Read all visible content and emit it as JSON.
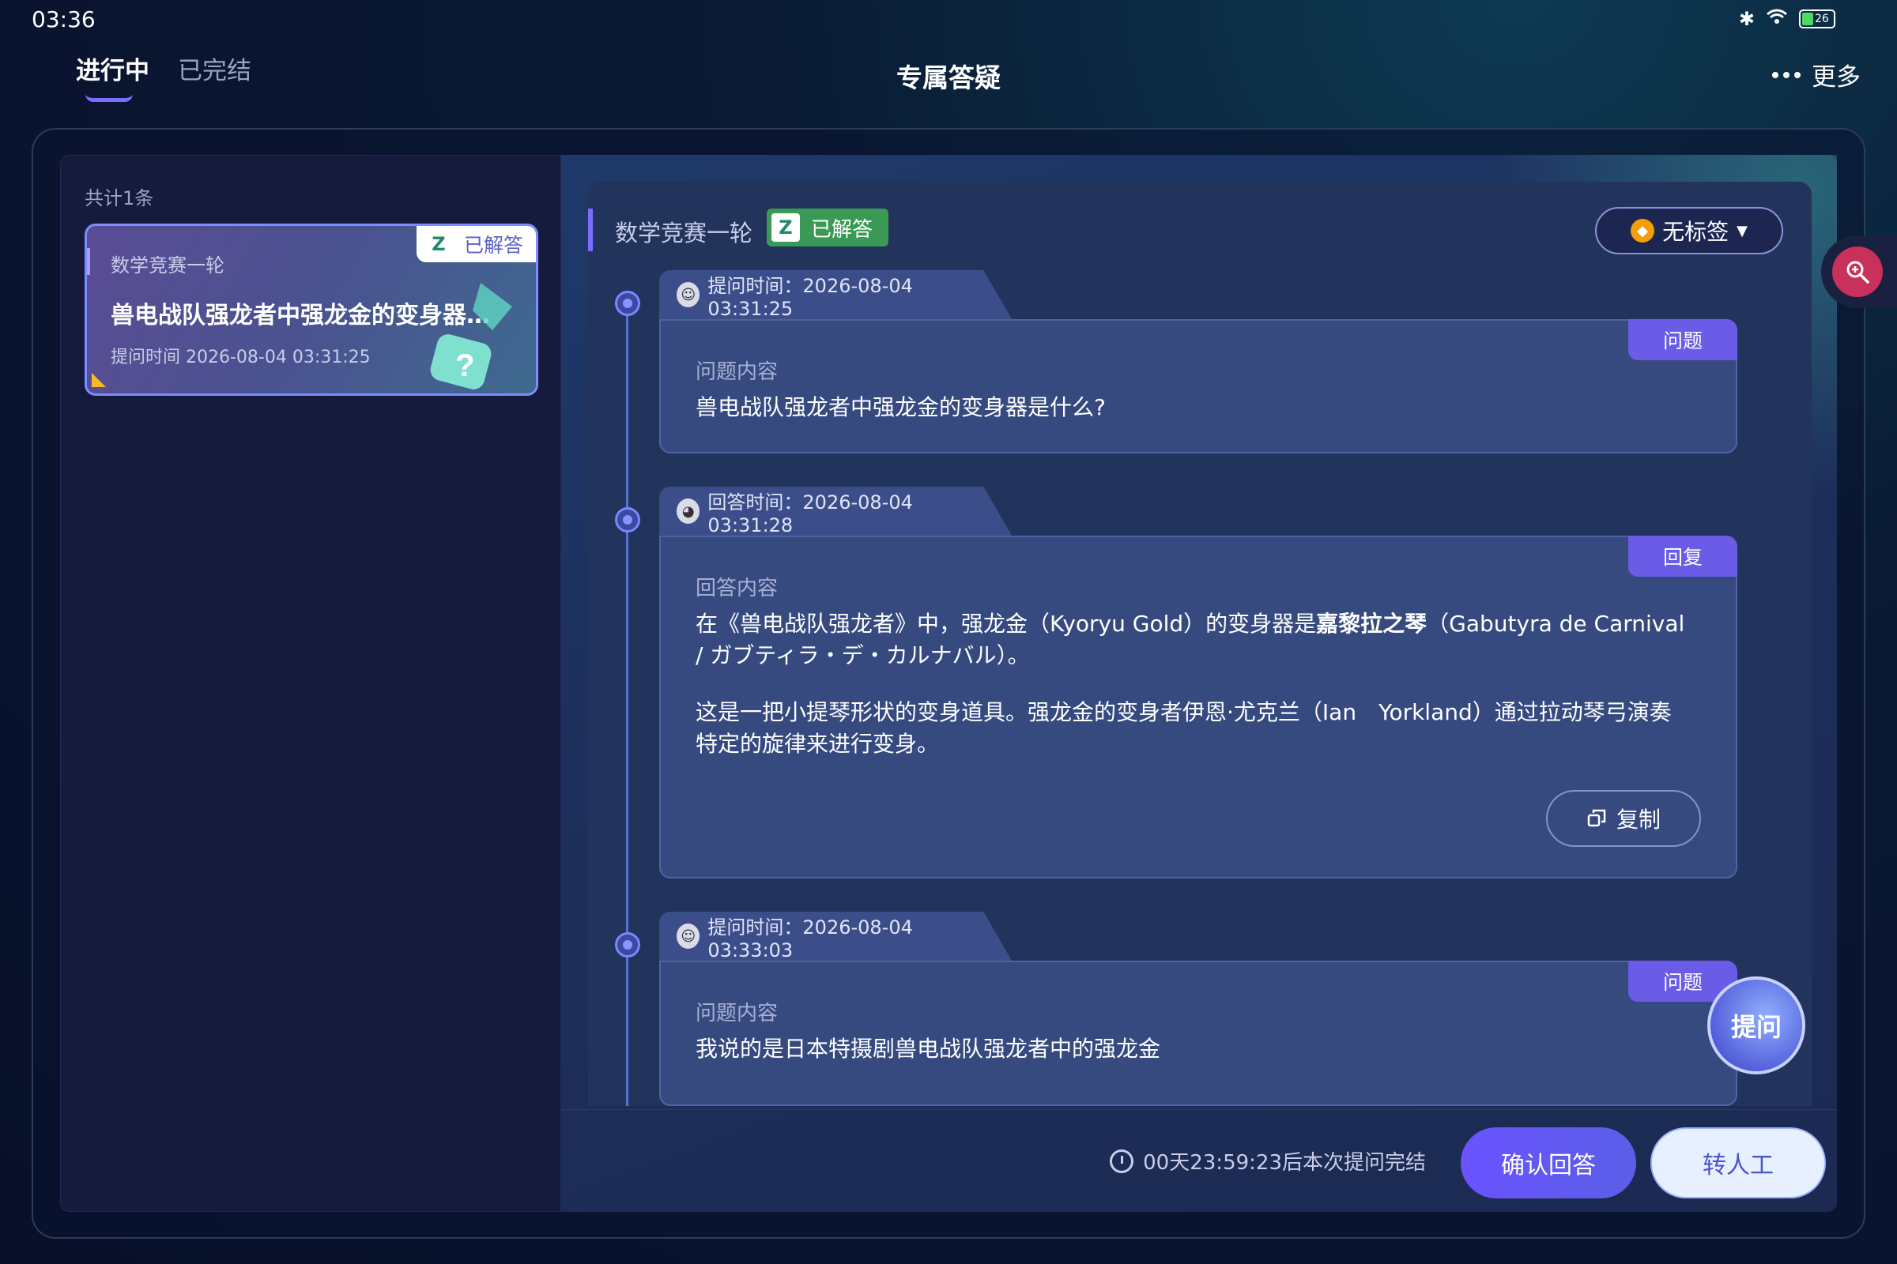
{
  "status_bar": {
    "time": "03:36",
    "battery": "26"
  },
  "header": {
    "tabs": [
      {
        "label": "进行中",
        "active": true
      },
      {
        "label": "已完结",
        "active": false
      }
    ],
    "title": "专属答疑",
    "more_label": "更多"
  },
  "list": {
    "count_label": "共计1条",
    "items": [
      {
        "category": "数学竞赛一轮",
        "title": "兽电战队强龙者中强龙金的变身器是什么？",
        "time": "提问时间 2026-08-04 03:31:25",
        "status": "已解答"
      }
    ]
  },
  "detail": {
    "category": "数学竞赛一轮",
    "status": "已解答",
    "tag_select": "无标签",
    "messages": [
      {
        "time": "提问时间：2026-08-04 03:31:25",
        "type": "问题",
        "label": "问题内容",
        "content": "兽电战队强龙者中强龙金的变身器是什么?"
      },
      {
        "time": "回答时间：2026-08-04 03:31:28",
        "type": "回复",
        "label": "回答内容",
        "p1_before": "在《兽电战队强龙者》中，强龙金（Kyoryu Gold）的变身器是",
        "p1_bold": "嘉黎拉之琴",
        "p1_after": "（Gabutyra de Carnival / ガブティラ・デ・カルナバル）。",
        "p2": "这是一把小提琴形状的变身道具。强龙金的变身者伊恩·尤克兰（Ian　Yorkland）通过拉动琴弓演奏特定的旋律来进行变身。",
        "copy_label": "复制"
      },
      {
        "time": "提问时间：2026-08-04 03:33:03",
        "type": "问题",
        "label": "问题内容",
        "content": "我说的是日本特摄剧兽电战队强龙者中的强龙金"
      }
    ]
  },
  "footer": {
    "timer": "00天23:59:23后本次提问完结",
    "confirm_label": "确认回答",
    "transfer_label": "转人工"
  },
  "ask_fab_label": "提问",
  "colors": {
    "accent": "#6b5ce7",
    "success": "#3a9a55",
    "background": "#0a1430"
  }
}
